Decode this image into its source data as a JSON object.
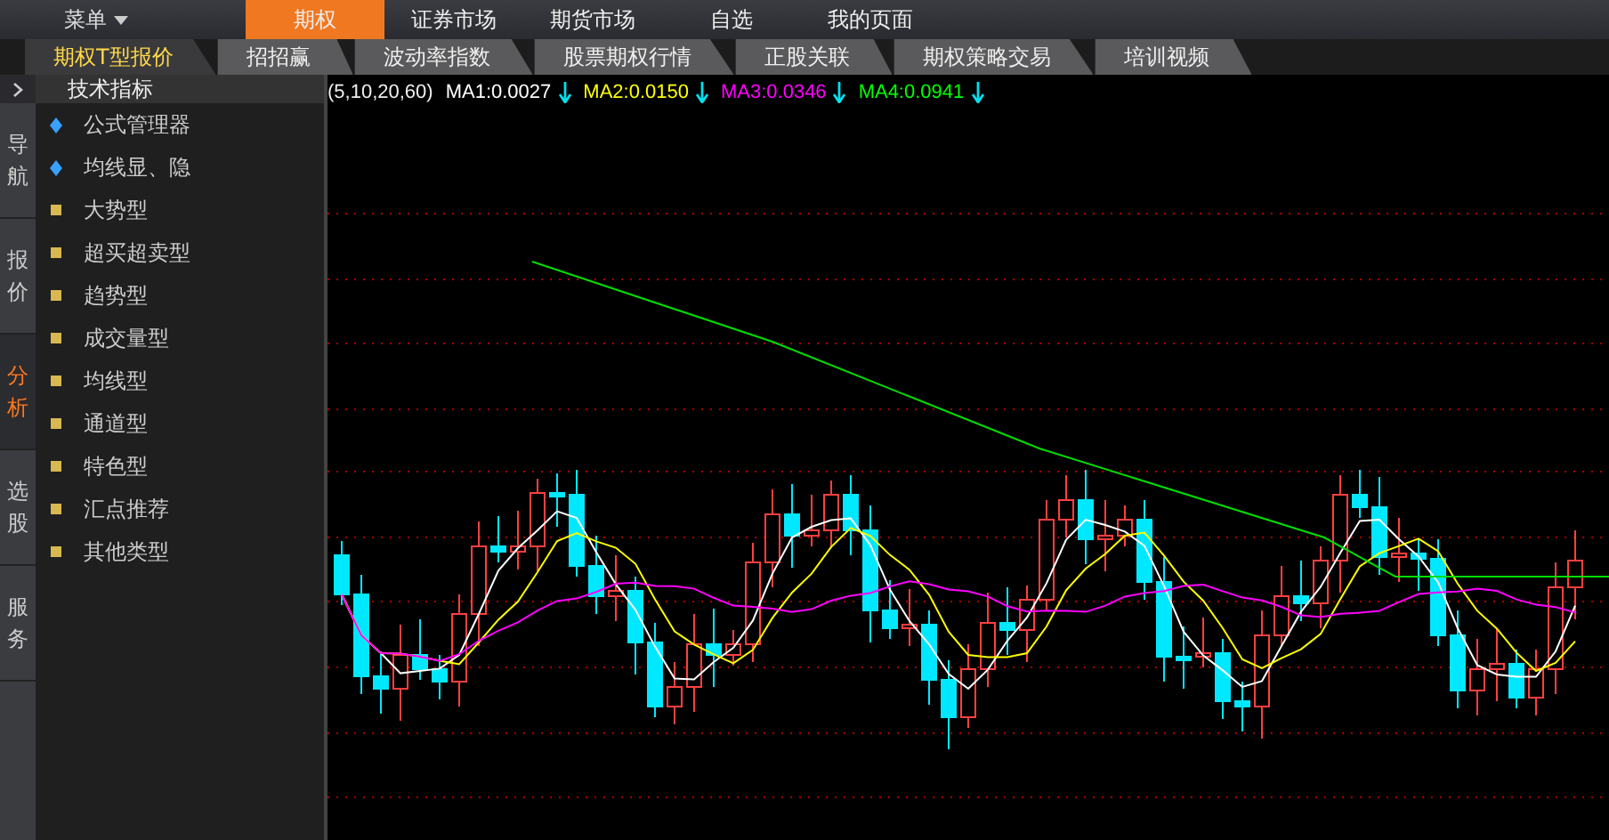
{
  "menu": {
    "label": "菜单"
  },
  "main_tabs": [
    {
      "label": "期权",
      "selected": true
    },
    {
      "label": "证券市场",
      "selected": false
    },
    {
      "label": "期货市场",
      "selected": false
    },
    {
      "label": "自选",
      "selected": false
    },
    {
      "label": "我的页面",
      "selected": false
    }
  ],
  "sub_tabs": [
    {
      "label": "期权T型报价",
      "selected": true
    },
    {
      "label": "招招赢",
      "selected": false
    },
    {
      "label": "波动率指数",
      "selected": false
    },
    {
      "label": "股票期权行情",
      "selected": false
    },
    {
      "label": "正股关联",
      "selected": false
    },
    {
      "label": "期权策略交易",
      "selected": false
    },
    {
      "label": "培训视频",
      "selected": false
    }
  ],
  "nav": [
    {
      "label": "导航",
      "selected": false
    },
    {
      "label": "报价",
      "selected": false
    },
    {
      "label": "分析",
      "selected": true
    },
    {
      "label": "选股",
      "selected": false
    },
    {
      "label": "服务",
      "selected": false
    }
  ],
  "panel": {
    "title": "技术指标",
    "items": [
      {
        "label": "公式管理器",
        "kind": "tool"
      },
      {
        "label": "均线显、隐",
        "kind": "tool"
      },
      {
        "label": "大势型",
        "kind": "category"
      },
      {
        "label": "超买超卖型",
        "kind": "category"
      },
      {
        "label": "趋势型",
        "kind": "category"
      },
      {
        "label": "成交量型",
        "kind": "category"
      },
      {
        "label": "均线型",
        "kind": "category"
      },
      {
        "label": "通道型",
        "kind": "category"
      },
      {
        "label": "特色型",
        "kind": "category"
      },
      {
        "label": "汇点推荐",
        "kind": "category"
      },
      {
        "label": "其他类型",
        "kind": "category"
      }
    ]
  },
  "chart": {
    "params": "(5,10,20,60)",
    "indicators": [
      {
        "label": "MA1:0.0027",
        "color": "#ffffff"
      },
      {
        "label": "MA2:0.0150",
        "color": "#ffff00"
      },
      {
        "label": "MA3:0.0346",
        "color": "#ff00ff"
      },
      {
        "label": "MA4:0.0941",
        "color": "#00ff00"
      }
    ]
  }
}
